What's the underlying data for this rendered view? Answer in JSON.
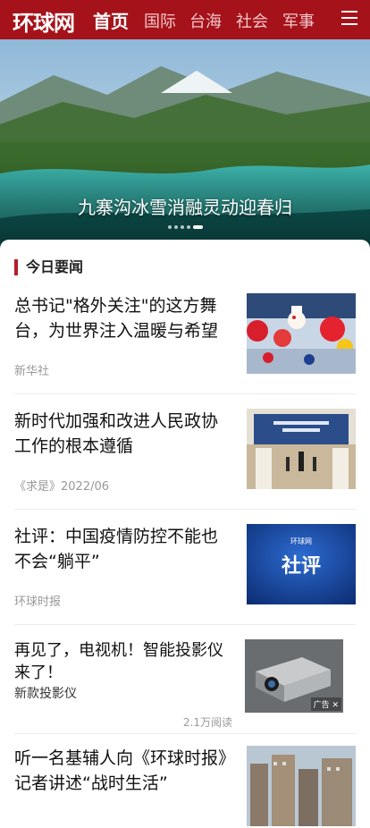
{
  "header": {
    "logo": "环球网",
    "nav": [
      "首页",
      "国际",
      "台海",
      "社会",
      "军事"
    ],
    "active_index": 0
  },
  "hero": {
    "caption": "九寨沟冰雪消融灵动迎春归",
    "dots": 5,
    "active_dot": 4
  },
  "section": {
    "title": "今日要闻"
  },
  "news": [
    {
      "title": "总书记\"格外关注\"的这方舞台，为世界注入温暖与希望",
      "source": "新华社"
    },
    {
      "title": "新时代加强和改进人民政协工作的根本遵循",
      "source": "《求是》2022/06"
    },
    {
      "title": "社评：中国疫情防控不能也不会“躺平”",
      "source": "环球时报",
      "thumb_text": "社评",
      "thumb_brand": "环球网"
    },
    {
      "title": "再见了，电视机！智能投影仪来了！",
      "subtitle": "新款投影仪",
      "reads": "2.1万阅读",
      "ad_label": "广告",
      "ad_close": "✕"
    },
    {
      "title": "听一名基辅人向《环球时报》记者讲述“战时生活”"
    }
  ]
}
